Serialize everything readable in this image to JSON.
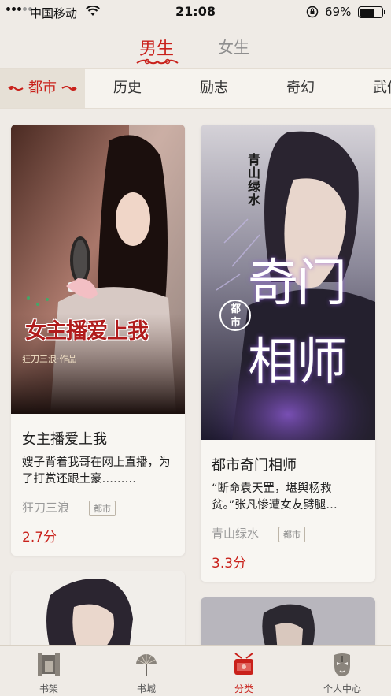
{
  "status_bar": {
    "carrier": "中国移动",
    "time": "21:08",
    "battery": "69%",
    "battery_level": 0.69
  },
  "gender_tabs": [
    {
      "label": "男生",
      "active": true
    },
    {
      "label": "女生",
      "active": false
    }
  ],
  "categories": [
    {
      "label": "都市",
      "active": true
    },
    {
      "label": "历史"
    },
    {
      "label": "励志"
    },
    {
      "label": "奇幻"
    },
    {
      "label": "武侠"
    }
  ],
  "books": [
    {
      "title": "女主播爱上我",
      "description": "嫂子背着我哥在网上直播，为了打赏还跟土豪………",
      "author": "狂刀三浪",
      "tag": "都市",
      "score": "2.7分",
      "cover_text": "女主播爱上我",
      "cover_byline": "狂刀三浪·作品"
    },
    {
      "title": "都市奇门相师",
      "description": "“断命袁天罡，堪舆杨救贫。”张凡惨遭女友劈腿…",
      "author": "青山绿水",
      "tag": "都市",
      "score": "3.3分",
      "cover_author": "青山绿水",
      "cover_badge": "都市",
      "cover_title_1": "奇门",
      "cover_title_2": "相师"
    }
  ],
  "tabbar": [
    {
      "label": "书架",
      "icon": "bookshelf-icon",
      "active": false
    },
    {
      "label": "书城",
      "icon": "bookstore-fan-icon",
      "active": false
    },
    {
      "label": "分类",
      "icon": "category-drum-icon",
      "active": true
    },
    {
      "label": "个人中心",
      "icon": "opera-mask-icon",
      "active": false
    }
  ],
  "colors": {
    "accent": "#c9211b",
    "background": "#efebe6",
    "card": "#f8f6f2"
  }
}
